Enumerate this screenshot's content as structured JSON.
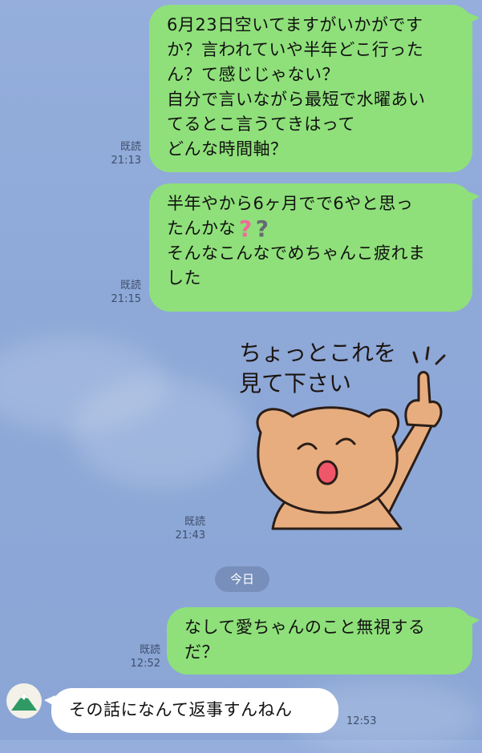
{
  "messages": [
    {
      "lines": [
        "6月23日空いてますがいかがです",
        "か？言われていや半年どこ行った",
        "ん？て感じじゃない？",
        "自分で言いながら最短で水曜あい",
        "てるとこ言うてきはって",
        "どんな時間軸？"
      ],
      "read": "既読",
      "time": "21:13"
    },
    {
      "lines": [
        "半年やから6ヶ月でで6やと思っ",
        "たんかな",
        "そんなこんなでめちゃんこ疲れま",
        "した"
      ],
      "read": "既読",
      "time": "21:15"
    },
    {
      "sticker_lines": [
        "ちょっとこれを",
        "見て下さい"
      ],
      "read": "既読",
      "time": "21:43"
    },
    {
      "lines": [
        "なして愛ちゃんのこと無視する",
        "だ？"
      ],
      "read": "既読",
      "time": "12:52"
    },
    {
      "text": "その話になんて返事すんねん",
      "time": "12:53"
    }
  ],
  "date_separator": "今日",
  "colors": {
    "outgoing": "#8fe07a",
    "incoming": "#ffffff",
    "background": "#8ea9d8"
  },
  "icons": {
    "question_pink": "question-mark-pink-icon",
    "question_gray": "question-mark-gray-icon"
  }
}
